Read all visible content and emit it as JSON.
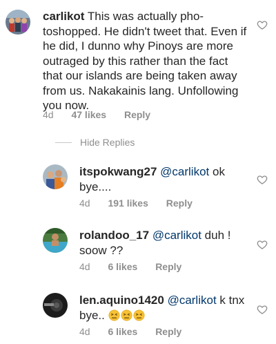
{
  "main_comment": {
    "username": "carlikot",
    "text": "This was actually pho-toshopped. He didn't tweet that. Even if he did, I dunno why Pinoys are more outraged by this rather than the fact that our islands are being taken away from us. Nakakainis lang. Unfollowing you now.",
    "time": "4d",
    "likes": "47 likes",
    "reply_label": "Reply"
  },
  "hide_replies_label": "Hide Replies",
  "replies": [
    {
      "username": "itspokwang27",
      "mention": "@carlikot",
      "text": "ok bye....",
      "time": "4d",
      "likes": "191 likes",
      "reply_label": "Reply"
    },
    {
      "username": "rolandoo_17",
      "mention": "@carlikot",
      "text": "duh ! soow ??",
      "time": "4d",
      "likes": "6 likes",
      "reply_label": "Reply"
    },
    {
      "username": "len.aquino1420",
      "mention": "@carlikot",
      "text": "k tnx bye..",
      "time": "4d",
      "likes": "6 likes",
      "reply_label": "Reply",
      "emojis": [
        "confounded-face",
        "confounded-face",
        "confounded-face"
      ]
    }
  ],
  "icons": {
    "like": "heart-outline-icon",
    "emoji": "confounded-face-emoji"
  },
  "colors": {
    "text": "#262626",
    "meta": "#8e8e8e",
    "mention": "#00376b"
  }
}
